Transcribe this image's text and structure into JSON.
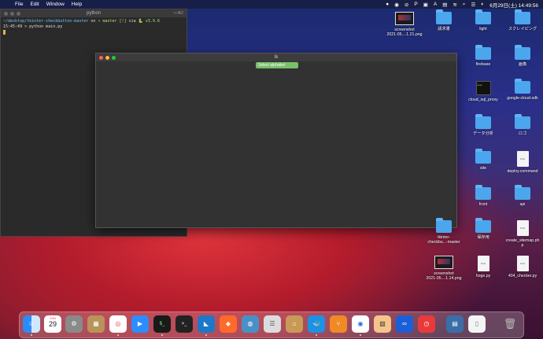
{
  "menubar": {
    "apple": "",
    "app_name": "python",
    "items": [
      "File",
      "Edit",
      "Window",
      "Help"
    ],
    "clock": "6月29日(土)  14:49:56"
  },
  "terminal": {
    "title": "python",
    "corner": "⌥⌘2",
    "line1": {
      "path": "~/desktop/tkinter-checkbutton-master",
      "on": "on",
      "branch": "master",
      "status": "[!]",
      "via": "via",
      "ver": "v3.9.6"
    },
    "line2": "15:45:49 > python main.py"
  },
  "tk_window": {
    "title": "tk",
    "select_button": "Select alphabet"
  },
  "desktop_icons": [
    {
      "label": "screenshot\n2021-05....1.21.png",
      "kind": "shot"
    },
    {
      "label": "請求書",
      "kind": "folder"
    },
    {
      "label": "light",
      "kind": "folder"
    },
    {
      "label": "スクレイピング",
      "kind": "folder"
    },
    {
      "label": "firebase",
      "kind": "folder"
    },
    {
      "label": "画像",
      "kind": "folder"
    },
    {
      "label": "cloud_sql_proxy",
      "kind": "term"
    },
    {
      "label": "google-cloud-sdk",
      "kind": "folder"
    },
    {
      "label": "データ分析",
      "kind": "folder"
    },
    {
      "label": "ロゴ",
      "kind": "folder"
    },
    {
      "label": "site",
      "kind": "folder"
    },
    {
      "label": "deploy.command",
      "kind": "file"
    },
    {
      "label": "front",
      "kind": "folder"
    },
    {
      "label": "api",
      "kind": "folder"
    },
    {
      "label": "tkinter-\ncheckbu...-master",
      "kind": "folder"
    },
    {
      "label": "保存用",
      "kind": "folder"
    },
    {
      "label": "create_sitemap.ph\np",
      "kind": "file"
    },
    {
      "label": "screenshot\n2021-05....1.14.png",
      "kind": "shot"
    },
    {
      "label": "hoge.py",
      "kind": "file"
    },
    {
      "label": "404_checker.py",
      "kind": "file"
    }
  ],
  "dock": {
    "calendar_month": "JUN",
    "calendar_day": "29"
  }
}
